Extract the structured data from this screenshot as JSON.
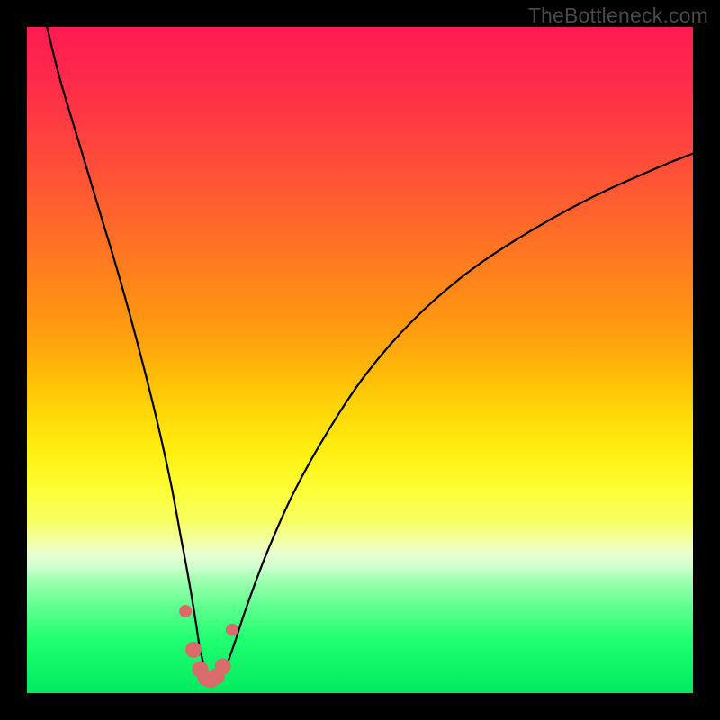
{
  "watermark": "TheBottleneck.com",
  "chart_data": {
    "type": "line",
    "title": "",
    "xlabel": "",
    "ylabel": "",
    "xlim": [
      0,
      100
    ],
    "ylim": [
      0,
      100
    ],
    "series": [
      {
        "name": "bottleneck-curve",
        "x": [
          3,
          5,
          8,
          11,
          14,
          17,
          19.5,
          21.5,
          23,
          24.3,
          25.3,
          26,
          26.8,
          27.6,
          28.5,
          29.5,
          31,
          33,
          36,
          40,
          45,
          51,
          58,
          66,
          75,
          85,
          95,
          100
        ],
        "values": [
          100,
          92,
          82,
          72,
          62,
          51,
          41,
          32,
          24,
          17,
          11,
          6.5,
          3.5,
          2,
          2,
          3,
          7,
          13,
          21,
          30,
          39,
          48,
          56,
          63,
          69,
          74.5,
          79,
          81
        ]
      }
    ],
    "markers": {
      "name": "highlight-points",
      "x": [
        23.8,
        25.0,
        26.0,
        26.8,
        27.6,
        28.5,
        29.4,
        30.8
      ],
      "values": [
        12.3,
        6.5,
        3.6,
        2.3,
        2.0,
        2.5,
        4.0,
        9.5
      ]
    },
    "gradient_bands": [
      {
        "color": "#ff1a52",
        "at": 100
      },
      {
        "color": "#ff9a10",
        "at": 55
      },
      {
        "color": "#fff010",
        "at": 36
      },
      {
        "color": "#f3ffa0",
        "at": 23
      },
      {
        "color": "#60ff90",
        "at": 13
      },
      {
        "color": "#00ea60",
        "at": 0
      }
    ]
  }
}
